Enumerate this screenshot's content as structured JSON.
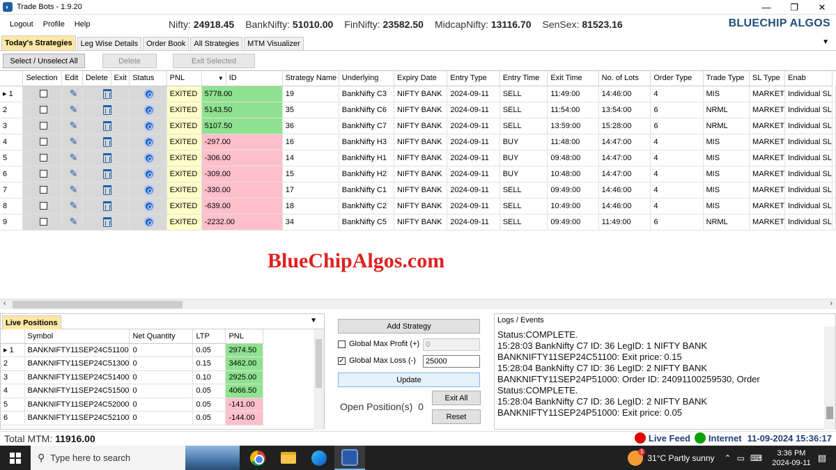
{
  "window": {
    "title": "Trade Bots - 1.9.20",
    "controls": [
      "minimize-icon",
      "restore-icon",
      "close-icon"
    ]
  },
  "menu": [
    "Logout",
    "Profile",
    "Help"
  ],
  "ticker": [
    {
      "label": "Nifty:",
      "value": "24918.45"
    },
    {
      "label": "BankNifty:",
      "value": "51010.00"
    },
    {
      "label": "FinNifty:",
      "value": "23582.50"
    },
    {
      "label": "MidcapNifty:",
      "value": "13116.70"
    },
    {
      "label": "SenSex:",
      "value": "81523.16"
    }
  ],
  "brand": "BLUECHIP ALGOS",
  "tabs": [
    "Today's Strategies",
    "Leg Wise Details",
    "Order Book",
    "All Strategies",
    "MTM Visualizer"
  ],
  "toolbar": {
    "select_all": "Select / Unselect All",
    "delete": "Delete",
    "exit_selected": "Exit Selected"
  },
  "grid": {
    "columns": [
      "Selection",
      "Edit",
      "Delete",
      "Exit",
      "Status",
      "PNL",
      "ID",
      "Strategy Name",
      "Underlying",
      "Expiry Date",
      "Entry Type",
      "Entry Time",
      "Exit Time",
      "No. of Lots",
      "Order Type",
      "Trade Type",
      "SL Type",
      "Enab"
    ],
    "rows": [
      {
        "n": "1",
        "status": "EXITED",
        "pnl": "5778.00",
        "sign": "pos",
        "id": "19",
        "name": "BankNifty C3",
        "underlying": "NIFTY BANK",
        "expiry": "2024-09-11",
        "entry_type": "SELL",
        "entry_time": "11:49:00",
        "exit_time": "14:46:00",
        "lots": "4",
        "order_type": "MIS",
        "trade_type": "MARKET",
        "sl_type": "Individual SL"
      },
      {
        "n": "2",
        "status": "EXITED",
        "pnl": "5143.50",
        "sign": "pos",
        "id": "35",
        "name": "BankNifty C6",
        "underlying": "NIFTY BANK",
        "expiry": "2024-09-11",
        "entry_type": "SELL",
        "entry_time": "11:54:00",
        "exit_time": "13:54:00",
        "lots": "6",
        "order_type": "NRML",
        "trade_type": "MARKET",
        "sl_type": "Individual SL"
      },
      {
        "n": "3",
        "status": "EXITED",
        "pnl": "5107.50",
        "sign": "pos",
        "id": "36",
        "name": "BankNifty C7",
        "underlying": "NIFTY BANK",
        "expiry": "2024-09-11",
        "entry_type": "SELL",
        "entry_time": "13:59:00",
        "exit_time": "15:28:00",
        "lots": "6",
        "order_type": "NRML",
        "trade_type": "MARKET",
        "sl_type": "Individual SL"
      },
      {
        "n": "4",
        "status": "EXITED",
        "pnl": "-297.00",
        "sign": "neg",
        "id": "16",
        "name": "BankNifty H3",
        "underlying": "NIFTY BANK",
        "expiry": "2024-09-11",
        "entry_type": "BUY",
        "entry_time": "11:48:00",
        "exit_time": "14:47:00",
        "lots": "4",
        "order_type": "MIS",
        "trade_type": "MARKET",
        "sl_type": "Individual SL"
      },
      {
        "n": "5",
        "status": "EXITED",
        "pnl": "-306.00",
        "sign": "neg",
        "id": "14",
        "name": "BankNifty H1",
        "underlying": "NIFTY BANK",
        "expiry": "2024-09-11",
        "entry_type": "BUY",
        "entry_time": "09:48:00",
        "exit_time": "14:47:00",
        "lots": "4",
        "order_type": "MIS",
        "trade_type": "MARKET",
        "sl_type": "Individual SL"
      },
      {
        "n": "6",
        "status": "EXITED",
        "pnl": "-309.00",
        "sign": "neg",
        "id": "15",
        "name": "BankNifty H2",
        "underlying": "NIFTY BANK",
        "expiry": "2024-09-11",
        "entry_type": "BUY",
        "entry_time": "10:48:00",
        "exit_time": "14:47:00",
        "lots": "4",
        "order_type": "MIS",
        "trade_type": "MARKET",
        "sl_type": "Individual SL"
      },
      {
        "n": "7",
        "status": "EXITED",
        "pnl": "-330.00",
        "sign": "neg",
        "id": "17",
        "name": "BankNifty C1",
        "underlying": "NIFTY BANK",
        "expiry": "2024-09-11",
        "entry_type": "SELL",
        "entry_time": "09:49:00",
        "exit_time": "14:46:00",
        "lots": "4",
        "order_type": "MIS",
        "trade_type": "MARKET",
        "sl_type": "Individual SL"
      },
      {
        "n": "8",
        "status": "EXITED",
        "pnl": "-639.00",
        "sign": "neg",
        "id": "18",
        "name": "BankNifty C2",
        "underlying": "NIFTY BANK",
        "expiry": "2024-09-11",
        "entry_type": "SELL",
        "entry_time": "10:49:00",
        "exit_time": "14:46:00",
        "lots": "4",
        "order_type": "MIS",
        "trade_type": "MARKET",
        "sl_type": "Individual SL"
      },
      {
        "n": "9",
        "status": "EXITED",
        "pnl": "-2232.00",
        "sign": "neg",
        "id": "34",
        "name": "BankNifty C5",
        "underlying": "NIFTY BANK",
        "expiry": "2024-09-11",
        "entry_type": "SELL",
        "entry_time": "09:49:00",
        "exit_time": "11:49:00",
        "lots": "6",
        "order_type": "NRML",
        "trade_type": "MARKET",
        "sl_type": "Individual SL"
      }
    ]
  },
  "watermark": "BlueChipAlgos.com",
  "live_positions": {
    "tab": "Live Positions",
    "columns": [
      "Symbol",
      "Net Quantity",
      "LTP",
      "PNL"
    ],
    "rows": [
      {
        "n": "1",
        "symbol": "BANKNIFTY11SEP24C51100",
        "qty": "0",
        "ltp": "0.05",
        "pnl": "2974.50",
        "sign": "pos"
      },
      {
        "n": "2",
        "symbol": "BANKNIFTY11SEP24C51300",
        "qty": "0",
        "ltp": "0.15",
        "pnl": "3462.00",
        "sign": "pos"
      },
      {
        "n": "3",
        "symbol": "BANKNIFTY11SEP24C51400",
        "qty": "0",
        "ltp": "0.10",
        "pnl": "2925.00",
        "sign": "pos"
      },
      {
        "n": "4",
        "symbol": "BANKNIFTY11SEP24C51500",
        "qty": "0",
        "ltp": "0.05",
        "pnl": "4066.50",
        "sign": "pos"
      },
      {
        "n": "5",
        "symbol": "BANKNIFTY11SEP24C52000",
        "qty": "0",
        "ltp": "0.05",
        "pnl": "-141.00",
        "sign": "neg"
      },
      {
        "n": "6",
        "symbol": "BANKNIFTY11SEP24C52100",
        "qty": "0",
        "ltp": "0.05",
        "pnl": "-144.00",
        "sign": "neg"
      }
    ]
  },
  "controls": {
    "add_strategy": "Add Strategy",
    "max_profit_label": "Global Max Profit (+)",
    "max_profit_checked": false,
    "max_profit_value": "0",
    "max_loss_label": "Global Max Loss (-)",
    "max_loss_checked": true,
    "max_loss_value": "25000",
    "update": "Update",
    "exit_all": "Exit All",
    "reset": "Reset",
    "open_positions_label": "Open Position(s)",
    "open_positions_value": "0"
  },
  "logs": {
    "title": "Logs / Events",
    "lines": [
      "Status:COMPLETE.",
      "15:28:03 BankNifty C7  ID: 36 LegID: 1   NIFTY BANK",
      "BANKNIFTY11SEP24C51100: Exit price: 0.15",
      "15:28:04 BankNifty C7  ID: 36 LegID: 2   NIFTY BANK",
      "BANKNIFTY11SEP24P51000: Order ID: 24091100259530, Order",
      "Status:COMPLETE.",
      "15:28:04 BankNifty C7  ID: 36 LegID: 2   NIFTY BANK",
      "BANKNIFTY11SEP24P51000: Exit price: 0.05"
    ]
  },
  "statusbar": {
    "total_label": "Total MTM:",
    "total_value": "11916.00",
    "live_feed": "Live Feed",
    "internet": "Internet",
    "datetime": "11-09-2024  15:36:17"
  },
  "taskbar": {
    "search_placeholder": "Type here to search",
    "weather": "31°C  Partly sunny",
    "time": "3:36 PM",
    "date": "2024-09-11"
  },
  "colors": {
    "pnl_positive": "#8fe28f",
    "pnl_negative": "#ffc0cb",
    "status_bg": "#ffffc8",
    "active_tab": "#ffe8a3",
    "brand": "#1f4e79",
    "watermark": "#e02020"
  }
}
